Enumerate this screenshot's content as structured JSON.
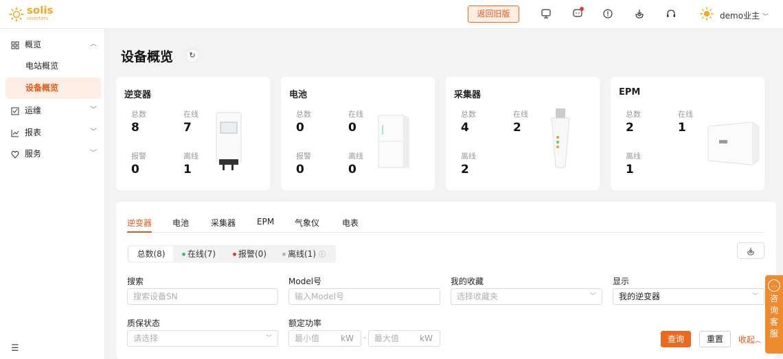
{
  "header": {
    "logo_text": "solis",
    "logo_sub": "inverters",
    "old_version_button": "返回旧版",
    "icons": [
      "monitor-icon",
      "message-icon",
      "alert-icon",
      "download-icon",
      "headset-icon"
    ],
    "user_name": "demo业主",
    "brand_color": "#e96b1f"
  },
  "sidebar": {
    "items": [
      {
        "icon": "grid-icon",
        "label": "概览",
        "expanded": true
      },
      {
        "icon": "maintenance-icon",
        "label": "运维",
        "expanded": false
      },
      {
        "icon": "report-icon",
        "label": "报表",
        "expanded": false
      },
      {
        "icon": "service-icon",
        "label": "服务",
        "expanded": false
      }
    ],
    "sub_items": [
      {
        "label": "电站概览",
        "active": false
      },
      {
        "label": "设备概览",
        "active": true
      }
    ]
  },
  "page": {
    "title": "设备概览"
  },
  "cards": [
    {
      "title": "逆变器",
      "stats": [
        {
          "label": "总数",
          "value": "8"
        },
        {
          "label": "在线",
          "value": "7"
        },
        {
          "label": "报警",
          "value": "0"
        },
        {
          "label": "离线",
          "value": "1"
        }
      ]
    },
    {
      "title": "电池",
      "stats": [
        {
          "label": "总数",
          "value": "0"
        },
        {
          "label": "在线",
          "value": "0"
        },
        {
          "label": "报警",
          "value": "0"
        },
        {
          "label": "离线",
          "value": "0"
        }
      ]
    },
    {
      "title": "采集器",
      "stats": [
        {
          "label": "总数",
          "value": "4"
        },
        {
          "label": "在线",
          "value": "2"
        },
        {
          "label": "离线",
          "value": "2"
        }
      ]
    },
    {
      "title": "EPM",
      "stats": [
        {
          "label": "总数",
          "value": "2"
        },
        {
          "label": "在线",
          "value": "1"
        },
        {
          "label": "离线",
          "value": "1"
        }
      ]
    }
  ],
  "tabs": [
    "逆变器",
    "电池",
    "采集器",
    "EPM",
    "气象仪",
    "电表"
  ],
  "status_filter": [
    {
      "label": "总数(8)",
      "dot": "",
      "active": true
    },
    {
      "label": "在线(7)",
      "dot": "#3fbf6b",
      "active": false
    },
    {
      "label": "报警(0)",
      "dot": "#e33b3b",
      "active": false
    },
    {
      "label": "离线(1)",
      "dot": "#b5b5b5",
      "active": false,
      "help_icon": "question-circle-icon"
    }
  ],
  "filters": {
    "search_label": "搜索",
    "search_placeholder": "搜索设备SN",
    "model_label": "Model号",
    "model_placeholder": "输入Model号",
    "favorite_label": "我的收藏",
    "favorite_placeholder": "选择收藏夹",
    "display_label": "显示",
    "display_value": "我的逆变器",
    "warranty_label": "质保状态",
    "warranty_placeholder": "请选择",
    "power_label": "额定功率",
    "power_min_placeholder": "最小值",
    "power_max_placeholder": "最大值",
    "power_unit": "kW",
    "power_separator": "-"
  },
  "actions": {
    "query": "查询",
    "reset": "重置",
    "collapse": "收起"
  },
  "consult": {
    "text": [
      "咨",
      "询",
      "客",
      "服"
    ]
  }
}
